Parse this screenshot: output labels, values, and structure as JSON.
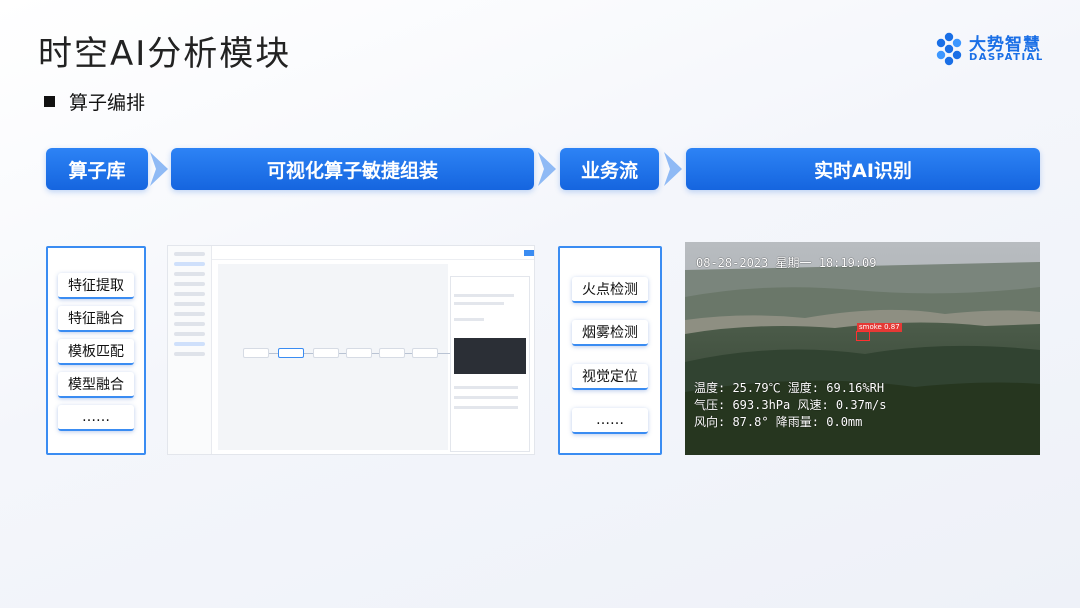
{
  "title": "时空AI分析模块",
  "logo": {
    "cn": "大势智慧",
    "en": "DASPATIAL"
  },
  "subtitle": "算子编排",
  "flow": [
    "算子库",
    "可视化算子敏捷组装",
    "业务流",
    "实时AI识别"
  ],
  "operators": [
    "特征提取",
    "特征融合",
    "模板匹配",
    "模型融合",
    "……"
  ],
  "business": [
    "火点检测",
    "烟雾检测",
    "视觉定位",
    "……"
  ],
  "camera": {
    "datetime": "08-28-2023  星期一  18:19:09",
    "detection_label": "smoke 0.87",
    "line1": "温度: 25.79℃  湿度: 69.16%RH",
    "line2": "气压: 693.3hPa  风速: 0.37m/s",
    "line3": "风向: 87.8°  降雨量: 0.0mm"
  },
  "colors": {
    "accent": "#1a6fe6",
    "bar": "#1565df",
    "border": "#3a8cf2",
    "detection": "#ff3030"
  }
}
